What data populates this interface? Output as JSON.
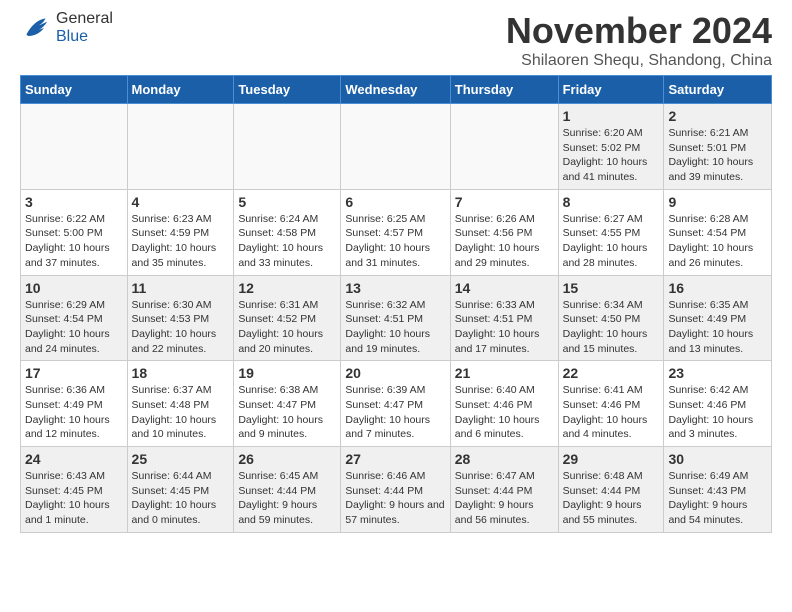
{
  "header": {
    "logo": {
      "general": "General",
      "blue": "Blue"
    },
    "title": "November 2024",
    "location": "Shilaoren Shequ, Shandong, China"
  },
  "calendar": {
    "days_of_week": [
      "Sunday",
      "Monday",
      "Tuesday",
      "Wednesday",
      "Thursday",
      "Friday",
      "Saturday"
    ],
    "weeks": [
      [
        {
          "day": "",
          "empty": true
        },
        {
          "day": "",
          "empty": true
        },
        {
          "day": "",
          "empty": true
        },
        {
          "day": "",
          "empty": true
        },
        {
          "day": "",
          "empty": true
        },
        {
          "day": "1",
          "sunrise": "6:20 AM",
          "sunset": "5:02 PM",
          "daylight": "10 hours and 41 minutes."
        },
        {
          "day": "2",
          "sunrise": "6:21 AM",
          "sunset": "5:01 PM",
          "daylight": "10 hours and 39 minutes."
        }
      ],
      [
        {
          "day": "3",
          "sunrise": "6:22 AM",
          "sunset": "5:00 PM",
          "daylight": "10 hours and 37 minutes."
        },
        {
          "day": "4",
          "sunrise": "6:23 AM",
          "sunset": "4:59 PM",
          "daylight": "10 hours and 35 minutes."
        },
        {
          "day": "5",
          "sunrise": "6:24 AM",
          "sunset": "4:58 PM",
          "daylight": "10 hours and 33 minutes."
        },
        {
          "day": "6",
          "sunrise": "6:25 AM",
          "sunset": "4:57 PM",
          "daylight": "10 hours and 31 minutes."
        },
        {
          "day": "7",
          "sunrise": "6:26 AM",
          "sunset": "4:56 PM",
          "daylight": "10 hours and 29 minutes."
        },
        {
          "day": "8",
          "sunrise": "6:27 AM",
          "sunset": "4:55 PM",
          "daylight": "10 hours and 28 minutes."
        },
        {
          "day": "9",
          "sunrise": "6:28 AM",
          "sunset": "4:54 PM",
          "daylight": "10 hours and 26 minutes."
        }
      ],
      [
        {
          "day": "10",
          "sunrise": "6:29 AM",
          "sunset": "4:54 PM",
          "daylight": "10 hours and 24 minutes."
        },
        {
          "day": "11",
          "sunrise": "6:30 AM",
          "sunset": "4:53 PM",
          "daylight": "10 hours and 22 minutes."
        },
        {
          "day": "12",
          "sunrise": "6:31 AM",
          "sunset": "4:52 PM",
          "daylight": "10 hours and 20 minutes."
        },
        {
          "day": "13",
          "sunrise": "6:32 AM",
          "sunset": "4:51 PM",
          "daylight": "10 hours and 19 minutes."
        },
        {
          "day": "14",
          "sunrise": "6:33 AM",
          "sunset": "4:51 PM",
          "daylight": "10 hours and 17 minutes."
        },
        {
          "day": "15",
          "sunrise": "6:34 AM",
          "sunset": "4:50 PM",
          "daylight": "10 hours and 15 minutes."
        },
        {
          "day": "16",
          "sunrise": "6:35 AM",
          "sunset": "4:49 PM",
          "daylight": "10 hours and 13 minutes."
        }
      ],
      [
        {
          "day": "17",
          "sunrise": "6:36 AM",
          "sunset": "4:49 PM",
          "daylight": "10 hours and 12 minutes."
        },
        {
          "day": "18",
          "sunrise": "6:37 AM",
          "sunset": "4:48 PM",
          "daylight": "10 hours and 10 minutes."
        },
        {
          "day": "19",
          "sunrise": "6:38 AM",
          "sunset": "4:47 PM",
          "daylight": "10 hours and 9 minutes."
        },
        {
          "day": "20",
          "sunrise": "6:39 AM",
          "sunset": "4:47 PM",
          "daylight": "10 hours and 7 minutes."
        },
        {
          "day": "21",
          "sunrise": "6:40 AM",
          "sunset": "4:46 PM",
          "daylight": "10 hours and 6 minutes."
        },
        {
          "day": "22",
          "sunrise": "6:41 AM",
          "sunset": "4:46 PM",
          "daylight": "10 hours and 4 minutes."
        },
        {
          "day": "23",
          "sunrise": "6:42 AM",
          "sunset": "4:46 PM",
          "daylight": "10 hours and 3 minutes."
        }
      ],
      [
        {
          "day": "24",
          "sunrise": "6:43 AM",
          "sunset": "4:45 PM",
          "daylight": "10 hours and 1 minute."
        },
        {
          "day": "25",
          "sunrise": "6:44 AM",
          "sunset": "4:45 PM",
          "daylight": "10 hours and 0 minutes."
        },
        {
          "day": "26",
          "sunrise": "6:45 AM",
          "sunset": "4:44 PM",
          "daylight": "9 hours and 59 minutes."
        },
        {
          "day": "27",
          "sunrise": "6:46 AM",
          "sunset": "4:44 PM",
          "daylight": "9 hours and 57 minutes."
        },
        {
          "day": "28",
          "sunrise": "6:47 AM",
          "sunset": "4:44 PM",
          "daylight": "9 hours and 56 minutes."
        },
        {
          "day": "29",
          "sunrise": "6:48 AM",
          "sunset": "4:44 PM",
          "daylight": "9 hours and 55 minutes."
        },
        {
          "day": "30",
          "sunrise": "6:49 AM",
          "sunset": "4:43 PM",
          "daylight": "9 hours and 54 minutes."
        }
      ]
    ]
  }
}
